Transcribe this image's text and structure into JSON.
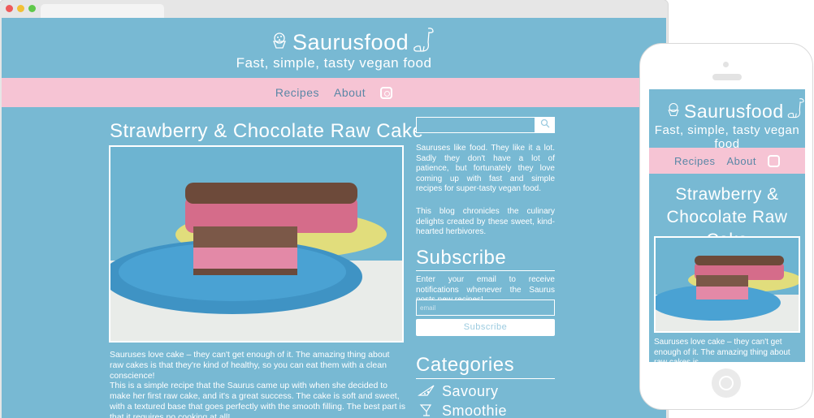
{
  "site": {
    "title": "Saurusfood",
    "tagline": "Fast, simple, tasty vegan food"
  },
  "nav": {
    "items": [
      {
        "label": "Recipes"
      },
      {
        "label": "About"
      }
    ],
    "instagram_icon": "instagram-icon"
  },
  "post": {
    "title": "Strawberry & Chocolate Raw Cake",
    "paragraph1": "Sauruses love cake – they can't get enough of it. The amazing thing about raw cakes is that they're kind of healthy, so you can eat them with a clean conscience!",
    "paragraph2": "This is a simple recipe that the Saurus came up with when she decided to make her first raw cake, and it's a great success. The cake is soft and sweet, with a textured base that goes perfectly with the smooth filling. The best part is that it requires no cooking at all!"
  },
  "sidebar": {
    "about1": "Sauruses like food. They like it a lot. Sadly they don't have a lot of patience, but fortunately they love coming up with fast and simple recipes for super-tasty vegan food.",
    "about2": "This blog chronicles the culinary delights created by these sweet, kind-hearted herbivores.",
    "subscribe_heading": "Subscribe",
    "subscribe_text": "Enter your email to receive notifications whenever the Saurus posts new recipes!",
    "email_placeholder": "email",
    "subscribe_button": "Subscribe",
    "categories_heading": "Categories",
    "categories": [
      {
        "label": "Savoury",
        "icon": "pizza-slice-icon"
      },
      {
        "label": "Smoothie",
        "icon": "cocktail-glass-icon"
      }
    ]
  },
  "mobile": {
    "title": "Saurusfood",
    "tagline": "Fast, simple, tasty vegan food",
    "nav": [
      {
        "label": "Recipes"
      },
      {
        "label": "About"
      }
    ],
    "post_title": "Strawberry & Chocolate Raw Cake",
    "post_excerpt": "Sauruses love cake – they can't get enough of it. The amazing thing about raw cakes is"
  },
  "colors": {
    "background": "#78b9d3",
    "nav_band": "#f6c4d4",
    "nav_text": "#5a87a6",
    "text": "#ffffff"
  }
}
